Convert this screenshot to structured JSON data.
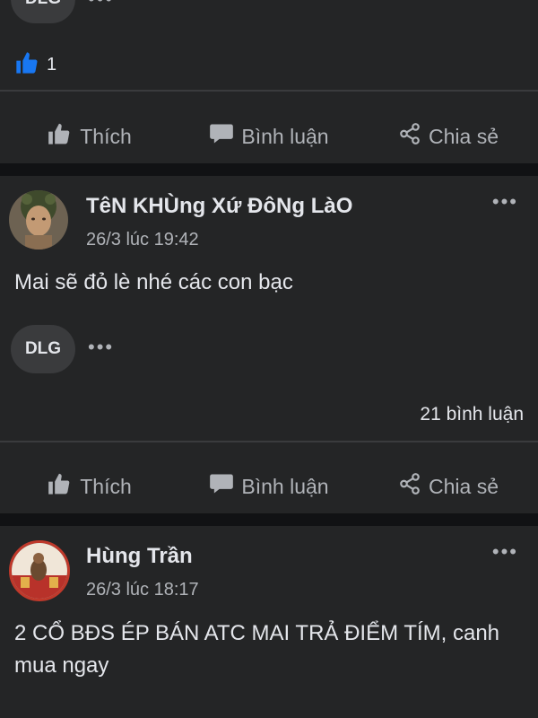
{
  "post0": {
    "tag_label": "DLG",
    "more_label": "•••",
    "likes_count": "1"
  },
  "actions": {
    "like": "Thích",
    "comment": "Bình luận",
    "share": "Chia sẻ"
  },
  "post1": {
    "author": "TêN KHÙng Xứ ĐôNg LàO",
    "time": "26/3 lúc 19:42",
    "text": "Mai sẽ đỏ lè nhé các con bạc",
    "tag_label": "DLG",
    "more_label": "•••",
    "comments_count": "21 bình luận",
    "menu_label": "•••"
  },
  "post2": {
    "author": "Hùng Trần",
    "time": "26/3 lúc 18:17",
    "text": "2 CỔ BĐS ÉP BÁN ATC MAI TRẢ ĐIỂM TÍM, canh mua ngay",
    "menu_label": "•••"
  },
  "colors": {
    "background": "#111214",
    "card": "#242526",
    "like_blue": "#1877f2",
    "text": "#e4e6eb",
    "muted": "#b0b3b8"
  }
}
